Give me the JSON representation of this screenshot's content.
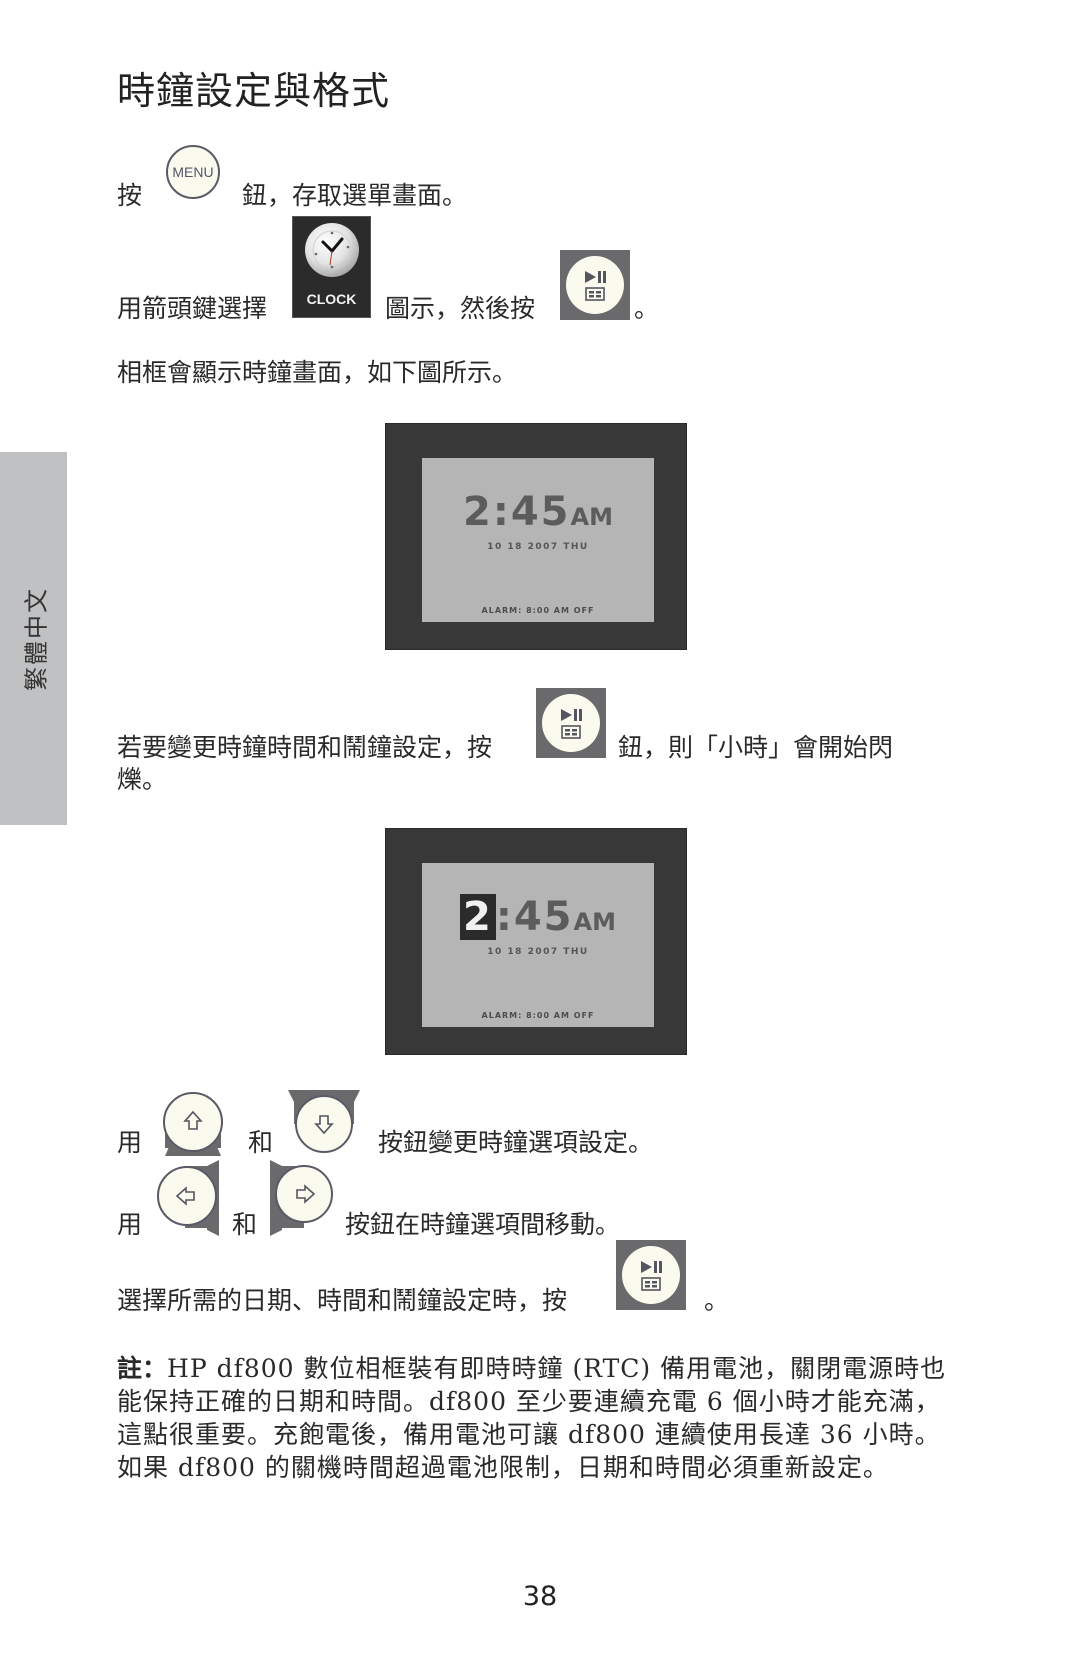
{
  "page": {
    "title": "時鐘設定與格式",
    "side_tab_label": "繁體中文",
    "page_number": "38"
  },
  "steps": {
    "step1": {
      "before": "按",
      "button_label": "MENU",
      "after": "鈕，存取選單畫面。"
    },
    "step2": {
      "before": "用箭頭鍵選擇",
      "icon_label": "CLOCK",
      "middle": "圖示，然後按",
      "after": "。"
    },
    "step3": {
      "text": "相框會顯示時鐘畫面，如下圖所示。"
    },
    "step4": {
      "before": "若要變更時鐘時間和鬧鐘設定，按",
      "after": "鈕，則「小時」會開始閃",
      "continuation": "爍。"
    },
    "step5": {
      "before": "用",
      "middle": "和",
      "after": "按鈕變更時鐘選項設定。"
    },
    "step6": {
      "before": "用",
      "middle": "和",
      "after": "按鈕在時鐘選項間移動。"
    },
    "step7": {
      "before": "選擇所需的日期、時間和鬧鐘設定時，按",
      "after": "。"
    }
  },
  "clock_screens": [
    {
      "hour": "2",
      "separator": ":",
      "minutes": "45",
      "ampm": "AM",
      "date": "10 18 2007 THU",
      "alarm": "ALARM: 8:00 AM OFF",
      "hour_highlighted": false
    },
    {
      "hour": "2",
      "separator": ":",
      "minutes": "45",
      "ampm": "AM",
      "date": "10 18 2007 THU",
      "alarm": "ALARM: 8:00 AM OFF",
      "hour_highlighted": true
    }
  ],
  "note": {
    "label": "註：",
    "text": "HP df800 數位相框裝有即時時鐘 (RTC) 備用電池，關閉電源時也能保持正確的日期和時間。df800 至少要連續充電 6 個小時才能充滿，這點很重要。充飽電後，備用電池可讓 df800 連續使用長達 36 小時。如果 df800 的關機時間超過電池限制，日期和時間必須重新設定。"
  },
  "icons": {
    "menu": "menu-button-icon",
    "clock": "clock-icon",
    "select": "play-pause-select-icon",
    "up": "arrow-up-icon",
    "down": "arrow-down-icon",
    "left": "arrow-left-icon",
    "right": "arrow-right-icon"
  },
  "colors": {
    "button_face": "#fbfaee",
    "button_bg": "#6a6a6c",
    "frame": "#383838",
    "screen": "#b5b5b5",
    "side_tab": "#c0c1c2"
  }
}
